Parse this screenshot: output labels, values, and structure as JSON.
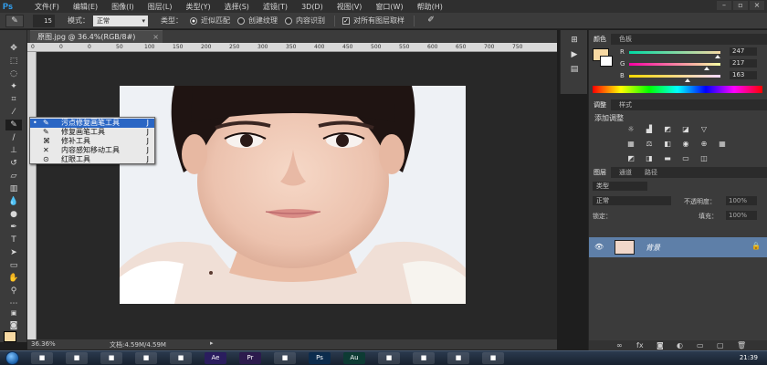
{
  "app": {
    "logo": "Ps",
    "menus": [
      "文件(F)",
      "编辑(E)",
      "图像(I)",
      "图层(L)",
      "类型(Y)",
      "选择(S)",
      "滤镜(T)",
      "3D(D)",
      "视图(V)",
      "窗口(W)",
      "帮助(H)"
    ]
  },
  "options": {
    "brush_size": "15",
    "mode_label": "模式：",
    "mode_value": "正常",
    "type_label": "类型：",
    "type_options": [
      "近似匹配",
      "创建纹理",
      "内容识别"
    ],
    "type_selected": "近似匹配",
    "sample_all_layers": "对所有图层取样"
  },
  "document": {
    "tab_title": "原图.jpg @ 36.4%(RGB/8#)",
    "ruler_top_ticks": [
      "0",
      "0",
      "0",
      "50",
      "100",
      "150",
      "200",
      "250",
      "300",
      "350",
      "400",
      "450",
      "500",
      "550",
      "600",
      "650",
      "700",
      "750"
    ],
    "zoom": "36.36%",
    "doc_size": "文档:4.59M/4.59M"
  },
  "flyout": {
    "items": [
      {
        "label": "污点修复画笔工具",
        "key": "J",
        "selected": true,
        "icon": "spot-healing-brush-icon"
      },
      {
        "label": "修复画笔工具",
        "key": "J",
        "selected": false,
        "icon": "healing-brush-icon"
      },
      {
        "label": "修补工具",
        "key": "J",
        "selected": false,
        "icon": "patch-icon"
      },
      {
        "label": "内容感知移动工具",
        "key": "J",
        "selected": false,
        "icon": "content-aware-move-icon"
      },
      {
        "label": "红眼工具",
        "key": "J",
        "selected": false,
        "icon": "red-eye-icon"
      }
    ]
  },
  "panels": {
    "color_tabs": [
      "颜色",
      "色板"
    ],
    "color": {
      "R": "247",
      "G": "217",
      "B": "163",
      "R_level": 247,
      "G_level": 217,
      "B_level": 163,
      "foreground_hex": "#f7d9a3"
    },
    "adjust_tabs": [
      "调整",
      "样式"
    ],
    "adjust_title": "添加调整",
    "layers_tabs": [
      "图层",
      "通道",
      "路径"
    ],
    "layers_filter": "类型",
    "blend_mode": "正常",
    "opacity_label": "不透明度：",
    "opacity_value": "100%",
    "lock_label": "锁定：",
    "fill_label": "填充：",
    "fill_value": "100%",
    "layer_name": "背景"
  },
  "taskbar": {
    "apps": [
      "ie-icon",
      "explorer-icon",
      "media-icon",
      "chrome-icon",
      "app-icon",
      "Ae",
      "Pr",
      "app-icon",
      "Ps",
      "Au",
      "app-icon",
      "app-icon",
      "app-icon",
      "app-icon"
    ],
    "time": "21:39"
  }
}
